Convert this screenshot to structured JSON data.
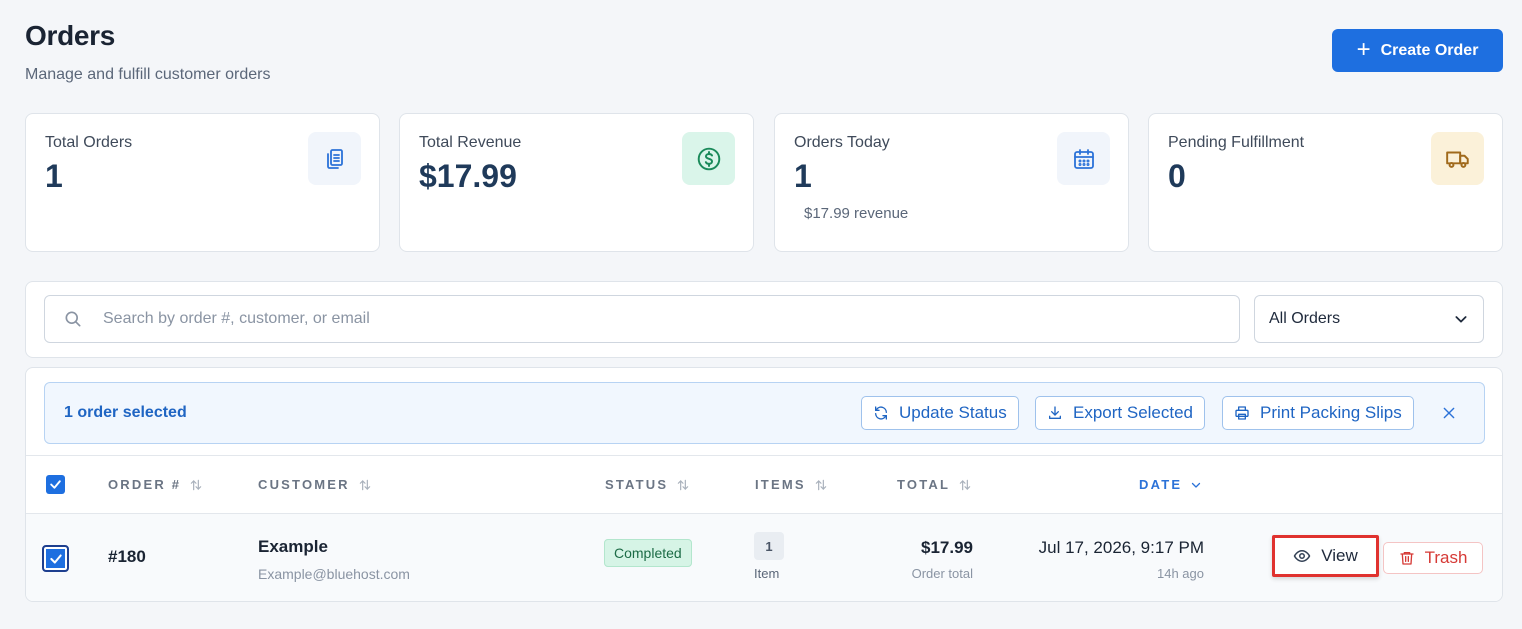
{
  "header": {
    "title": "Orders",
    "subtitle": "Manage and fulfill customer orders",
    "create_label": "Create Order"
  },
  "stats": [
    {
      "label": "Total Orders",
      "value": "1",
      "sub": "",
      "icon": "clipboard-icon",
      "color": "#2b72d8",
      "bg": "#f1f5fb"
    },
    {
      "label": "Total Revenue",
      "value": "$17.99",
      "sub": "",
      "icon": "dollar-icon",
      "color": "#1a8a5a",
      "bg": "#daf5ea"
    },
    {
      "label": "Orders Today",
      "value": "1",
      "sub": "$17.99 revenue",
      "icon": "calendar-icon",
      "color": "#2b72d8",
      "bg": "#f1f5fb"
    },
    {
      "label": "Pending Fulfillment",
      "value": "0",
      "sub": "",
      "icon": "truck-icon",
      "color": "#a06a1c",
      "bg": "#fbf1d9"
    }
  ],
  "search": {
    "placeholder": "Search by order #, customer, or email",
    "filter_value": "All Orders"
  },
  "bulk": {
    "selected_text": "1 order selected",
    "update_status": "Update Status",
    "export_selected": "Export Selected",
    "print_slips": "Print Packing Slips"
  },
  "table": {
    "columns": {
      "order": "ORDER #",
      "customer": "CUSTOMER",
      "status": "STATUS",
      "items": "ITEMS",
      "total": "TOTAL",
      "date": "DATE"
    },
    "rows": [
      {
        "order": "#180",
        "customer_name": "Example",
        "customer_email": "Example@bluehost.com",
        "status": "Completed",
        "items_count": "1",
        "items_label": "Item",
        "total": "$17.99",
        "total_sub": "Order total",
        "date": "Jul 17, 2026, 9:17 PM",
        "date_sub": "14h ago",
        "view_label": "View",
        "trash_label": "Trash"
      }
    ]
  },
  "colors": {
    "accent": "#1e6fe0",
    "danger": "#d63a36",
    "highlight": "#e0322f"
  }
}
